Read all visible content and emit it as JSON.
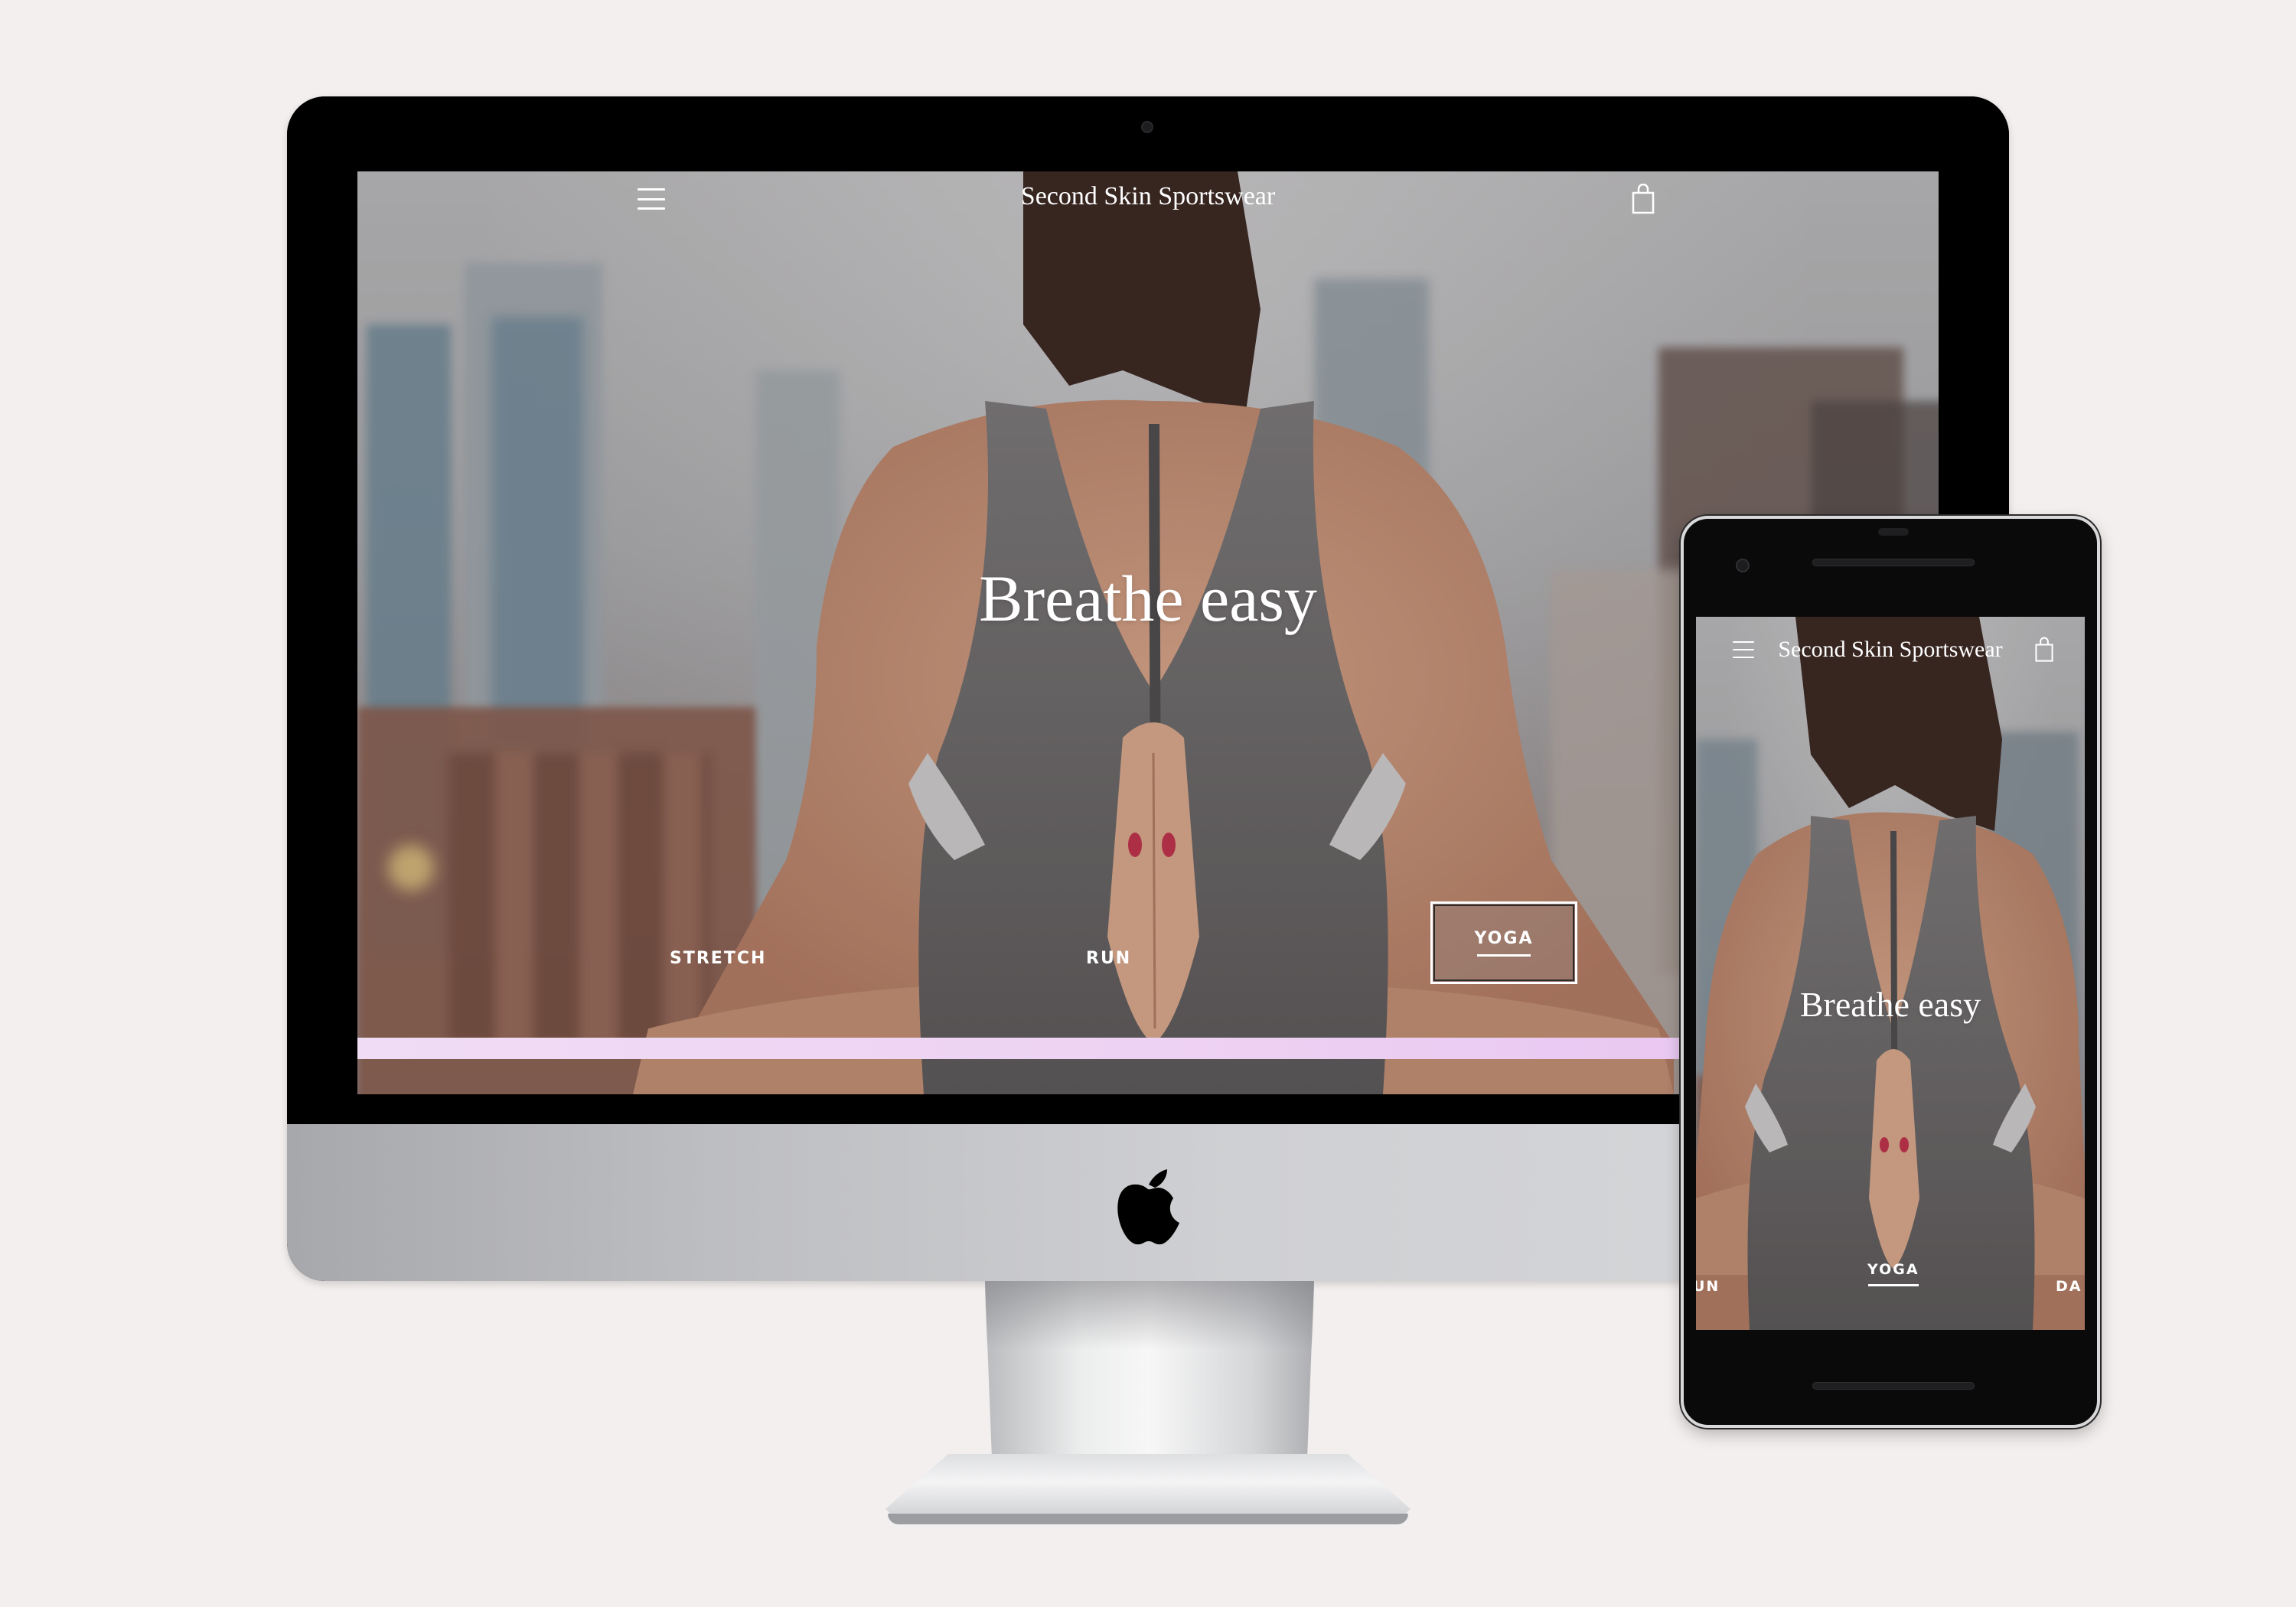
{
  "site": {
    "title": "Second Skin Sportswear",
    "headline": "Breathe easy",
    "menu_icon": "hamburger-menu-icon",
    "cart_icon": "shopping-bag-icon"
  },
  "desktop": {
    "categories": [
      {
        "label": "STRETCH",
        "active": false
      },
      {
        "label": "RUN",
        "active": false
      },
      {
        "label": "YOGA",
        "active": true
      }
    ]
  },
  "mobile": {
    "categories": [
      {
        "label": "UN",
        "active": false
      },
      {
        "label": "YOGA",
        "active": true
      },
      {
        "label": "DA",
        "active": false
      }
    ]
  },
  "devices": {
    "desktop": "iMac",
    "desktop_logo": "apple-logo",
    "mobile": "smartphone"
  },
  "colors": {
    "background": "#f3efee",
    "promo_bar": "#eed2f3",
    "text_on_hero": "#ffffff"
  }
}
